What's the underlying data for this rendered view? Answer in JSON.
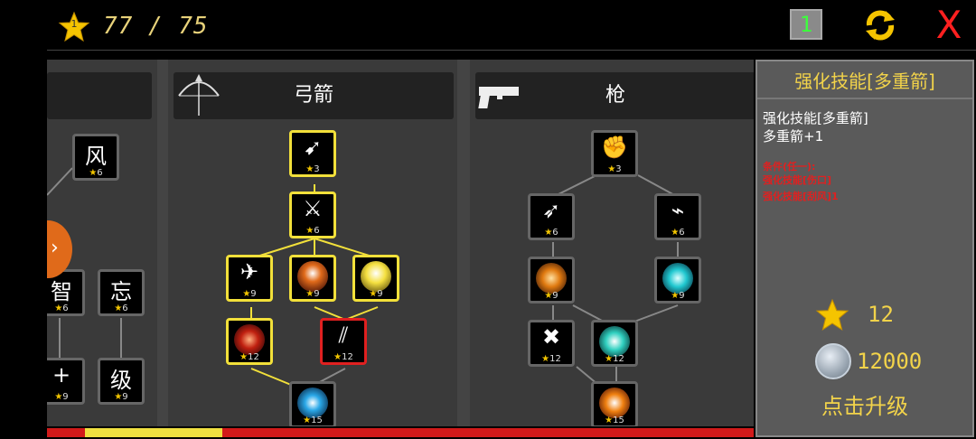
{
  "top": {
    "level": "1",
    "progress": "77 / 75",
    "badge": "1",
    "close_label": "X"
  },
  "columns": {
    "left": {
      "nodes": [
        {
          "glyph": "风",
          "cost": "6"
        },
        {
          "glyph": "智",
          "cost": "6"
        },
        {
          "glyph": "忘",
          "cost": "6"
        },
        {
          "glyph": "+",
          "cost": "9"
        },
        {
          "glyph": "级",
          "cost": "9"
        }
      ],
      "arrow": "›"
    },
    "bow": {
      "title": "弓箭",
      "icon": "bow-icon",
      "nodes": [
        {
          "cost": "3"
        },
        {
          "cost": "6"
        },
        {
          "cost": "9"
        },
        {
          "cost": "9"
        },
        {
          "cost": "9"
        },
        {
          "cost": "12"
        },
        {
          "cost": "12"
        },
        {
          "cost": "15"
        }
      ]
    },
    "gun": {
      "title": "枪",
      "icon": "pistol-icon",
      "nodes": [
        {
          "cost": "3"
        },
        {
          "cost": "6"
        },
        {
          "cost": "6"
        },
        {
          "cost": "9"
        },
        {
          "cost": "9"
        },
        {
          "cost": "12"
        },
        {
          "cost": "12"
        },
        {
          "cost": "15"
        }
      ]
    }
  },
  "panel": {
    "title": "强化技能[多重箭]",
    "desc1": "强化技能[多重箭]",
    "desc2": "多重箭+1",
    "conditions": [
      "条件(任一):",
      "强化技能[伤口]",
      "强化技能[刮风]1"
    ],
    "star_cost": "12",
    "coin_cost": "12000",
    "upgrade_label": "点击升级"
  },
  "colors": {
    "accent": "#f2d34a",
    "unlocked_border": "#f2e03a",
    "selected_border": "#e02020",
    "close": "#ff2020"
  },
  "bottom_bar": {
    "filled_fraction": 0.25
  }
}
